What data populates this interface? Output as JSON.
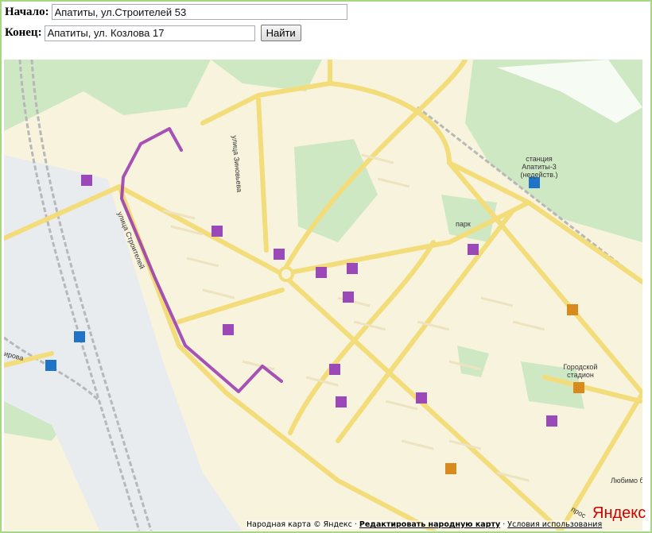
{
  "form": {
    "start_label": "Начало:",
    "start_value": "Апатиты, ул.Строителей 53",
    "end_label": "Конец:",
    "end_value": "Апатиты, ул. Козлова 17",
    "find_button": "Найти"
  },
  "map": {
    "labels": {
      "zinovieva": "улица Зиновьева",
      "stroiteley": "улица Строителей",
      "station": "станция Апатиты-3 (недейств.)",
      "park": "парк",
      "stadium": "Городской стадион",
      "lyubimo": "Любимо б",
      "kirova": "ирова",
      "prosp": "прос"
    },
    "route_color": "#9b3fb0",
    "logo": "Яндекс"
  },
  "footer": {
    "copyright": "Народная карта © Яндекс ·",
    "edit_link": "Редактировать народную карту",
    "sep": "·",
    "terms_link": "Условия использования"
  }
}
